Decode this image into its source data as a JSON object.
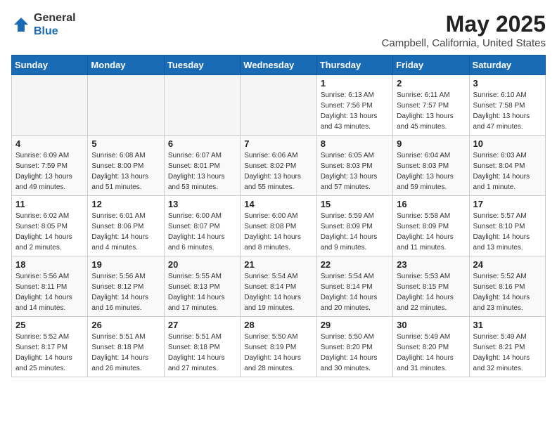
{
  "header": {
    "logo_line1": "General",
    "logo_line2": "Blue",
    "title": "May 2025",
    "location": "Campbell, California, United States"
  },
  "days_of_week": [
    "Sunday",
    "Monday",
    "Tuesday",
    "Wednesday",
    "Thursday",
    "Friday",
    "Saturday"
  ],
  "weeks": [
    [
      {
        "day": "",
        "info": ""
      },
      {
        "day": "",
        "info": ""
      },
      {
        "day": "",
        "info": ""
      },
      {
        "day": "",
        "info": ""
      },
      {
        "day": "1",
        "info": "Sunrise: 6:13 AM\nSunset: 7:56 PM\nDaylight: 13 hours\nand 43 minutes."
      },
      {
        "day": "2",
        "info": "Sunrise: 6:11 AM\nSunset: 7:57 PM\nDaylight: 13 hours\nand 45 minutes."
      },
      {
        "day": "3",
        "info": "Sunrise: 6:10 AM\nSunset: 7:58 PM\nDaylight: 13 hours\nand 47 minutes."
      }
    ],
    [
      {
        "day": "4",
        "info": "Sunrise: 6:09 AM\nSunset: 7:59 PM\nDaylight: 13 hours\nand 49 minutes."
      },
      {
        "day": "5",
        "info": "Sunrise: 6:08 AM\nSunset: 8:00 PM\nDaylight: 13 hours\nand 51 minutes."
      },
      {
        "day": "6",
        "info": "Sunrise: 6:07 AM\nSunset: 8:01 PM\nDaylight: 13 hours\nand 53 minutes."
      },
      {
        "day": "7",
        "info": "Sunrise: 6:06 AM\nSunset: 8:02 PM\nDaylight: 13 hours\nand 55 minutes."
      },
      {
        "day": "8",
        "info": "Sunrise: 6:05 AM\nSunset: 8:03 PM\nDaylight: 13 hours\nand 57 minutes."
      },
      {
        "day": "9",
        "info": "Sunrise: 6:04 AM\nSunset: 8:03 PM\nDaylight: 13 hours\nand 59 minutes."
      },
      {
        "day": "10",
        "info": "Sunrise: 6:03 AM\nSunset: 8:04 PM\nDaylight: 14 hours\nand 1 minute."
      }
    ],
    [
      {
        "day": "11",
        "info": "Sunrise: 6:02 AM\nSunset: 8:05 PM\nDaylight: 14 hours\nand 2 minutes."
      },
      {
        "day": "12",
        "info": "Sunrise: 6:01 AM\nSunset: 8:06 PM\nDaylight: 14 hours\nand 4 minutes."
      },
      {
        "day": "13",
        "info": "Sunrise: 6:00 AM\nSunset: 8:07 PM\nDaylight: 14 hours\nand 6 minutes."
      },
      {
        "day": "14",
        "info": "Sunrise: 6:00 AM\nSunset: 8:08 PM\nDaylight: 14 hours\nand 8 minutes."
      },
      {
        "day": "15",
        "info": "Sunrise: 5:59 AM\nSunset: 8:09 PM\nDaylight: 14 hours\nand 9 minutes."
      },
      {
        "day": "16",
        "info": "Sunrise: 5:58 AM\nSunset: 8:09 PM\nDaylight: 14 hours\nand 11 minutes."
      },
      {
        "day": "17",
        "info": "Sunrise: 5:57 AM\nSunset: 8:10 PM\nDaylight: 14 hours\nand 13 minutes."
      }
    ],
    [
      {
        "day": "18",
        "info": "Sunrise: 5:56 AM\nSunset: 8:11 PM\nDaylight: 14 hours\nand 14 minutes."
      },
      {
        "day": "19",
        "info": "Sunrise: 5:56 AM\nSunset: 8:12 PM\nDaylight: 14 hours\nand 16 minutes."
      },
      {
        "day": "20",
        "info": "Sunrise: 5:55 AM\nSunset: 8:13 PM\nDaylight: 14 hours\nand 17 minutes."
      },
      {
        "day": "21",
        "info": "Sunrise: 5:54 AM\nSunset: 8:14 PM\nDaylight: 14 hours\nand 19 minutes."
      },
      {
        "day": "22",
        "info": "Sunrise: 5:54 AM\nSunset: 8:14 PM\nDaylight: 14 hours\nand 20 minutes."
      },
      {
        "day": "23",
        "info": "Sunrise: 5:53 AM\nSunset: 8:15 PM\nDaylight: 14 hours\nand 22 minutes."
      },
      {
        "day": "24",
        "info": "Sunrise: 5:52 AM\nSunset: 8:16 PM\nDaylight: 14 hours\nand 23 minutes."
      }
    ],
    [
      {
        "day": "25",
        "info": "Sunrise: 5:52 AM\nSunset: 8:17 PM\nDaylight: 14 hours\nand 25 minutes."
      },
      {
        "day": "26",
        "info": "Sunrise: 5:51 AM\nSunset: 8:18 PM\nDaylight: 14 hours\nand 26 minutes."
      },
      {
        "day": "27",
        "info": "Sunrise: 5:51 AM\nSunset: 8:18 PM\nDaylight: 14 hours\nand 27 minutes."
      },
      {
        "day": "28",
        "info": "Sunrise: 5:50 AM\nSunset: 8:19 PM\nDaylight: 14 hours\nand 28 minutes."
      },
      {
        "day": "29",
        "info": "Sunrise: 5:50 AM\nSunset: 8:20 PM\nDaylight: 14 hours\nand 30 minutes."
      },
      {
        "day": "30",
        "info": "Sunrise: 5:49 AM\nSunset: 8:20 PM\nDaylight: 14 hours\nand 31 minutes."
      },
      {
        "day": "31",
        "info": "Sunrise: 5:49 AM\nSunset: 8:21 PM\nDaylight: 14 hours\nand 32 minutes."
      }
    ]
  ]
}
